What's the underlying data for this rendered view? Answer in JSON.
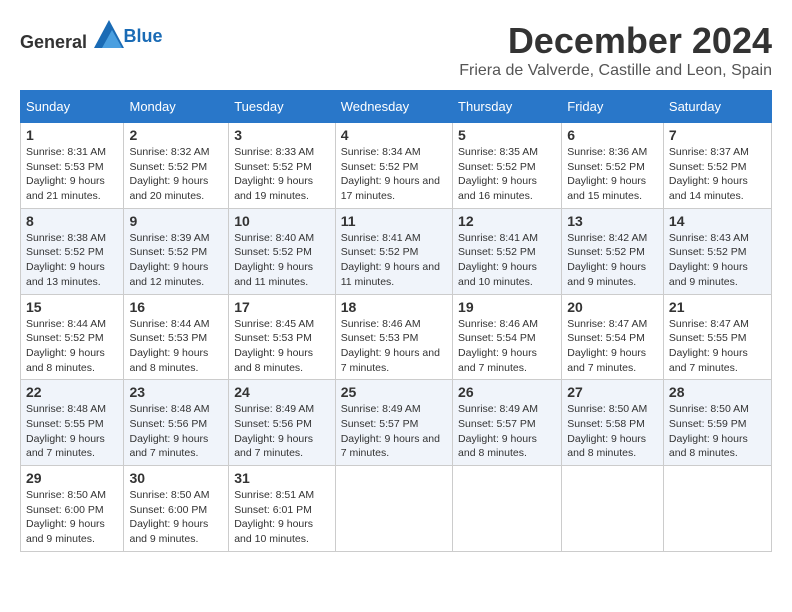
{
  "logo": {
    "text_general": "General",
    "text_blue": "Blue"
  },
  "title": "December 2024",
  "location": "Friera de Valverde, Castille and Leon, Spain",
  "days_of_week": [
    "Sunday",
    "Monday",
    "Tuesday",
    "Wednesday",
    "Thursday",
    "Friday",
    "Saturday"
  ],
  "weeks": [
    [
      {
        "day": "1",
        "sunrise": "8:31 AM",
        "sunset": "5:53 PM",
        "daylight": "9 hours and 21 minutes."
      },
      {
        "day": "2",
        "sunrise": "8:32 AM",
        "sunset": "5:52 PM",
        "daylight": "9 hours and 20 minutes."
      },
      {
        "day": "3",
        "sunrise": "8:33 AM",
        "sunset": "5:52 PM",
        "daylight": "9 hours and 19 minutes."
      },
      {
        "day": "4",
        "sunrise": "8:34 AM",
        "sunset": "5:52 PM",
        "daylight": "9 hours and 17 minutes."
      },
      {
        "day": "5",
        "sunrise": "8:35 AM",
        "sunset": "5:52 PM",
        "daylight": "9 hours and 16 minutes."
      },
      {
        "day": "6",
        "sunrise": "8:36 AM",
        "sunset": "5:52 PM",
        "daylight": "9 hours and 15 minutes."
      },
      {
        "day": "7",
        "sunrise": "8:37 AM",
        "sunset": "5:52 PM",
        "daylight": "9 hours and 14 minutes."
      }
    ],
    [
      {
        "day": "8",
        "sunrise": "8:38 AM",
        "sunset": "5:52 PM",
        "daylight": "9 hours and 13 minutes."
      },
      {
        "day": "9",
        "sunrise": "8:39 AM",
        "sunset": "5:52 PM",
        "daylight": "9 hours and 12 minutes."
      },
      {
        "day": "10",
        "sunrise": "8:40 AM",
        "sunset": "5:52 PM",
        "daylight": "9 hours and 11 minutes."
      },
      {
        "day": "11",
        "sunrise": "8:41 AM",
        "sunset": "5:52 PM",
        "daylight": "9 hours and 11 minutes."
      },
      {
        "day": "12",
        "sunrise": "8:41 AM",
        "sunset": "5:52 PM",
        "daylight": "9 hours and 10 minutes."
      },
      {
        "day": "13",
        "sunrise": "8:42 AM",
        "sunset": "5:52 PM",
        "daylight": "9 hours and 9 minutes."
      },
      {
        "day": "14",
        "sunrise": "8:43 AM",
        "sunset": "5:52 PM",
        "daylight": "9 hours and 9 minutes."
      }
    ],
    [
      {
        "day": "15",
        "sunrise": "8:44 AM",
        "sunset": "5:52 PM",
        "daylight": "9 hours and 8 minutes."
      },
      {
        "day": "16",
        "sunrise": "8:44 AM",
        "sunset": "5:53 PM",
        "daylight": "9 hours and 8 minutes."
      },
      {
        "day": "17",
        "sunrise": "8:45 AM",
        "sunset": "5:53 PM",
        "daylight": "9 hours and 8 minutes."
      },
      {
        "day": "18",
        "sunrise": "8:46 AM",
        "sunset": "5:53 PM",
        "daylight": "9 hours and 7 minutes."
      },
      {
        "day": "19",
        "sunrise": "8:46 AM",
        "sunset": "5:54 PM",
        "daylight": "9 hours and 7 minutes."
      },
      {
        "day": "20",
        "sunrise": "8:47 AM",
        "sunset": "5:54 PM",
        "daylight": "9 hours and 7 minutes."
      },
      {
        "day": "21",
        "sunrise": "8:47 AM",
        "sunset": "5:55 PM",
        "daylight": "9 hours and 7 minutes."
      }
    ],
    [
      {
        "day": "22",
        "sunrise": "8:48 AM",
        "sunset": "5:55 PM",
        "daylight": "9 hours and 7 minutes."
      },
      {
        "day": "23",
        "sunrise": "8:48 AM",
        "sunset": "5:56 PM",
        "daylight": "9 hours and 7 minutes."
      },
      {
        "day": "24",
        "sunrise": "8:49 AM",
        "sunset": "5:56 PM",
        "daylight": "9 hours and 7 minutes."
      },
      {
        "day": "25",
        "sunrise": "8:49 AM",
        "sunset": "5:57 PM",
        "daylight": "9 hours and 7 minutes."
      },
      {
        "day": "26",
        "sunrise": "8:49 AM",
        "sunset": "5:57 PM",
        "daylight": "9 hours and 8 minutes."
      },
      {
        "day": "27",
        "sunrise": "8:50 AM",
        "sunset": "5:58 PM",
        "daylight": "9 hours and 8 minutes."
      },
      {
        "day": "28",
        "sunrise": "8:50 AM",
        "sunset": "5:59 PM",
        "daylight": "9 hours and 8 minutes."
      }
    ],
    [
      {
        "day": "29",
        "sunrise": "8:50 AM",
        "sunset": "6:00 PM",
        "daylight": "9 hours and 9 minutes."
      },
      {
        "day": "30",
        "sunrise": "8:50 AM",
        "sunset": "6:00 PM",
        "daylight": "9 hours and 9 minutes."
      },
      {
        "day": "31",
        "sunrise": "8:51 AM",
        "sunset": "6:01 PM",
        "daylight": "9 hours and 10 minutes."
      },
      null,
      null,
      null,
      null
    ]
  ],
  "labels": {
    "sunrise": "Sunrise:",
    "sunset": "Sunset:",
    "daylight": "Daylight:"
  }
}
